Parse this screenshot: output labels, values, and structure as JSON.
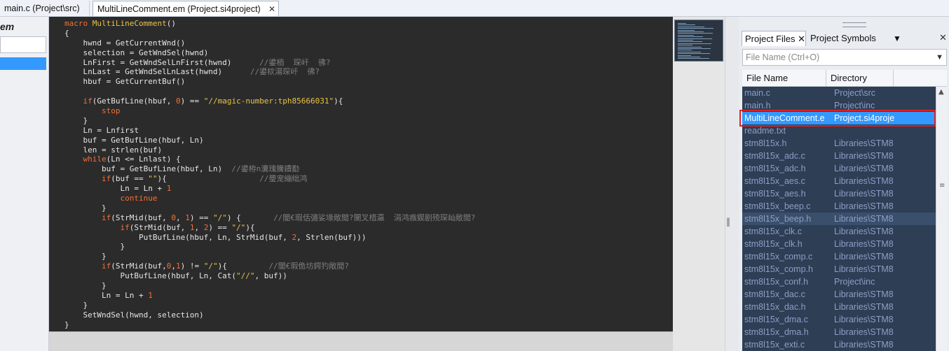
{
  "tabs": [
    {
      "label": "main.c (Project\\src)"
    },
    {
      "label": "MultiLineComment.em (Project.si4project)",
      "close": "✕"
    }
  ],
  "left_panel": {
    "title": "em"
  },
  "editor": {
    "lines": [
      [
        [
          "kw",
          "macro "
        ],
        [
          "fn",
          "MultiLineComment"
        ],
        [
          "pl",
          "()"
        ]
      ],
      [
        [
          "pl",
          "{"
        ]
      ],
      [
        [
          "pl",
          "    hwnd = GetCurrentWnd()"
        ]
      ],
      [
        [
          "pl",
          "    selection = GetWndSel(hwnd)"
        ]
      ],
      [
        [
          "pl",
          "    LnFirst = GetWndSelLnFirst(hwnd)      "
        ],
        [
          "cm",
          "//鍙栭  琛屽  彿?"
        ]
      ],
      [
        [
          "pl",
          "    LnLast = GetWndSelLnLast(hwnd)      "
        ],
        [
          "cm",
          "//鍙栨湯琛屽  彿?"
        ]
      ],
      [
        [
          "pl",
          "    hbuf = GetCurrentBuf()"
        ]
      ],
      [
        [
          "pl",
          ""
        ]
      ],
      [
        [
          "kw",
          "    if"
        ],
        [
          "pl",
          "(GetBufLine(hbuf, "
        ],
        [
          "num",
          "0"
        ],
        [
          "pl",
          ") == "
        ],
        [
          "str",
          "\"//magic-number:tph85666031\""
        ],
        [
          "pl",
          "){"
        ]
      ],
      [
        [
          "kw",
          "        stop"
        ]
      ],
      [
        [
          "pl",
          "    }"
        ]
      ],
      [
        [
          "pl",
          "    Ln = Lnfirst"
        ]
      ],
      [
        [
          "pl",
          "    buf = GetBufLine(hbuf, Ln)"
        ]
      ],
      [
        [
          "pl",
          "    len = strlen(buf)"
        ]
      ],
      [
        [
          "kw",
          "    while"
        ],
        [
          "pl",
          "(Ln <= Lnlast) {"
        ]
      ],
      [
        [
          "pl",
          "        buf = GetBufLine(hbuf, Ln)  "
        ],
        [
          "cm",
          "//鍙栫n瀵瑰簲鐨勫"
        ]
      ],
      [
        [
          "kw",
          "        if"
        ],
        [
          "pl",
          "(buf == "
        ],
        [
          "str",
          "\"\""
        ],
        [
          "pl",
          "){                    "
        ],
        [
          "cm",
          "//璺宠繃绌鸿"
        ]
      ],
      [
        [
          "pl",
          "            Ln = Ln + "
        ],
        [
          "num",
          "1"
        ]
      ],
      [
        [
          "kw",
          "            continue"
        ]
      ],
      [
        [
          "pl",
          "        }"
        ]
      ],
      [
        [
          "kw",
          "        if"
        ],
        [
          "pl",
          "(StrMid(buf, "
        ],
        [
          "num",
          "0"
        ],
        [
          "pl",
          ", "
        ],
        [
          "num",
          "1"
        ],
        [
          "pl",
          ") == "
        ],
        [
          "str",
          "\"/\""
        ],
        [
          "pl",
          ") {       "
        ],
        [
          "cm",
          "//闇€瑕佸彇娑堟敞閲?闃叉棤瀛  涓鸿瘯鍥剧殑琛屾敞閲?"
        ]
      ],
      [
        [
          "kw",
          "            if"
        ],
        [
          "pl",
          "(StrMid(buf, "
        ],
        [
          "num",
          "1"
        ],
        [
          "pl",
          ", "
        ],
        [
          "num",
          "2"
        ],
        [
          "pl",
          ") == "
        ],
        [
          "str",
          "\"/\""
        ],
        [
          "pl",
          "){"
        ]
      ],
      [
        [
          "pl",
          "                PutBufLine(hbuf, Ln, StrMid(buf, "
        ],
        [
          "num",
          "2"
        ],
        [
          "pl",
          ", Strlen(buf)))"
        ]
      ],
      [
        [
          "pl",
          "            }"
        ]
      ],
      [
        [
          "pl",
          "        }"
        ]
      ],
      [
        [
          "kw",
          "        if"
        ],
        [
          "pl",
          "(StrMid(buf,"
        ],
        [
          "num",
          "0"
        ],
        [
          "pl",
          ","
        ],
        [
          "num",
          "1"
        ],
        [
          "pl",
          ") != "
        ],
        [
          "str",
          "\"/\""
        ],
        [
          "pl",
          "){         "
        ],
        [
          "cm",
          "//闇€瑕佹坊鍔犳敞閲?"
        ]
      ],
      [
        [
          "pl",
          "            PutBufLine(hbuf, Ln, Cat("
        ],
        [
          "str",
          "\"//\""
        ],
        [
          "pl",
          ", buf))"
        ]
      ],
      [
        [
          "pl",
          "        }"
        ]
      ],
      [
        [
          "pl",
          "        Ln = Ln + "
        ],
        [
          "num",
          "1"
        ]
      ],
      [
        [
          "pl",
          "    }"
        ]
      ],
      [
        [
          "pl",
          "    SetWndSel(hwnd, selection)"
        ]
      ],
      [
        [
          "pl",
          "}"
        ]
      ]
    ]
  },
  "right_panel": {
    "tabs": {
      "files": "Project Files ✕",
      "symbols": "Project Symbols",
      "more": "▼",
      "close": "✕"
    },
    "filter": {
      "placeholder": "File Name (Ctrl+O)",
      "arrow": "▼"
    },
    "columns": {
      "name": "File Name",
      "directory": "Directory"
    },
    "files": [
      {
        "name": "main.c",
        "dir": "Project\\src"
      },
      {
        "name": "main.h",
        "dir": "Project\\inc"
      },
      {
        "name": "MultiLineComment.e",
        "dir": "Project.si4proje",
        "selected": true
      },
      {
        "name": "readme.txt",
        "dir": ""
      },
      {
        "name": "stm8l15x.h",
        "dir": "Libraries\\STM8"
      },
      {
        "name": "stm8l15x_adc.c",
        "dir": "Libraries\\STM8"
      },
      {
        "name": "stm8l15x_adc.h",
        "dir": "Libraries\\STM8"
      },
      {
        "name": "stm8l15x_aes.c",
        "dir": "Libraries\\STM8"
      },
      {
        "name": "stm8l15x_aes.h",
        "dir": "Libraries\\STM8"
      },
      {
        "name": "stm8l15x_beep.c",
        "dir": "Libraries\\STM8"
      },
      {
        "name": "stm8l15x_beep.h",
        "dir": "Libraries\\STM8",
        "hover": true
      },
      {
        "name": "stm8l15x_clk.c",
        "dir": "Libraries\\STM8"
      },
      {
        "name": "stm8l15x_clk.h",
        "dir": "Libraries\\STM8"
      },
      {
        "name": "stm8l15x_comp.c",
        "dir": "Libraries\\STM8"
      },
      {
        "name": "stm8l15x_comp.h",
        "dir": "Libraries\\STM8"
      },
      {
        "name": "stm8l15x_conf.h",
        "dir": "Project\\inc"
      },
      {
        "name": "stm8l15x_dac.c",
        "dir": "Libraries\\STM8"
      },
      {
        "name": "stm8l15x_dac.h",
        "dir": "Libraries\\STM8"
      },
      {
        "name": "stm8l15x_dma.c",
        "dir": "Libraries\\STM8"
      },
      {
        "name": "stm8l15x_dma.h",
        "dir": "Libraries\\STM8"
      },
      {
        "name": "stm8l15x_exti.c",
        "dir": "Libraries\\STM8"
      }
    ]
  },
  "colors": {
    "selection": "#3399ff",
    "highlight_box": "#e02020",
    "keyword": "#f07038",
    "string": "#e8c34a",
    "comment": "#7f7f7f"
  },
  "icons": {
    "splitter": "splitter-grip-icon",
    "scroll_up": "scroll-up-icon"
  }
}
